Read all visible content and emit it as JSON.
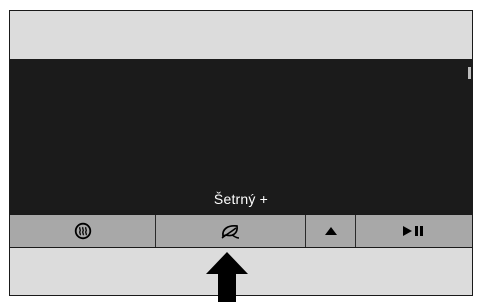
{
  "display": {
    "mode_label": "Šetrný +"
  },
  "buttons": [
    {
      "name": "heat-button",
      "icon": "heat-waves-icon"
    },
    {
      "name": "eco-button",
      "icon": "leaf-icon"
    },
    {
      "name": "up-button",
      "icon": "triangle-up-icon"
    },
    {
      "name": "play-pause-button",
      "icon": "play-pause-icon"
    }
  ],
  "annotation": {
    "arrow_icon": "arrow-up-icon"
  },
  "colors": {
    "display_background": "#1b1b1b",
    "panel_background": "#dcdcdc",
    "button_background": "#a8a8a8",
    "ink": "#000000"
  }
}
